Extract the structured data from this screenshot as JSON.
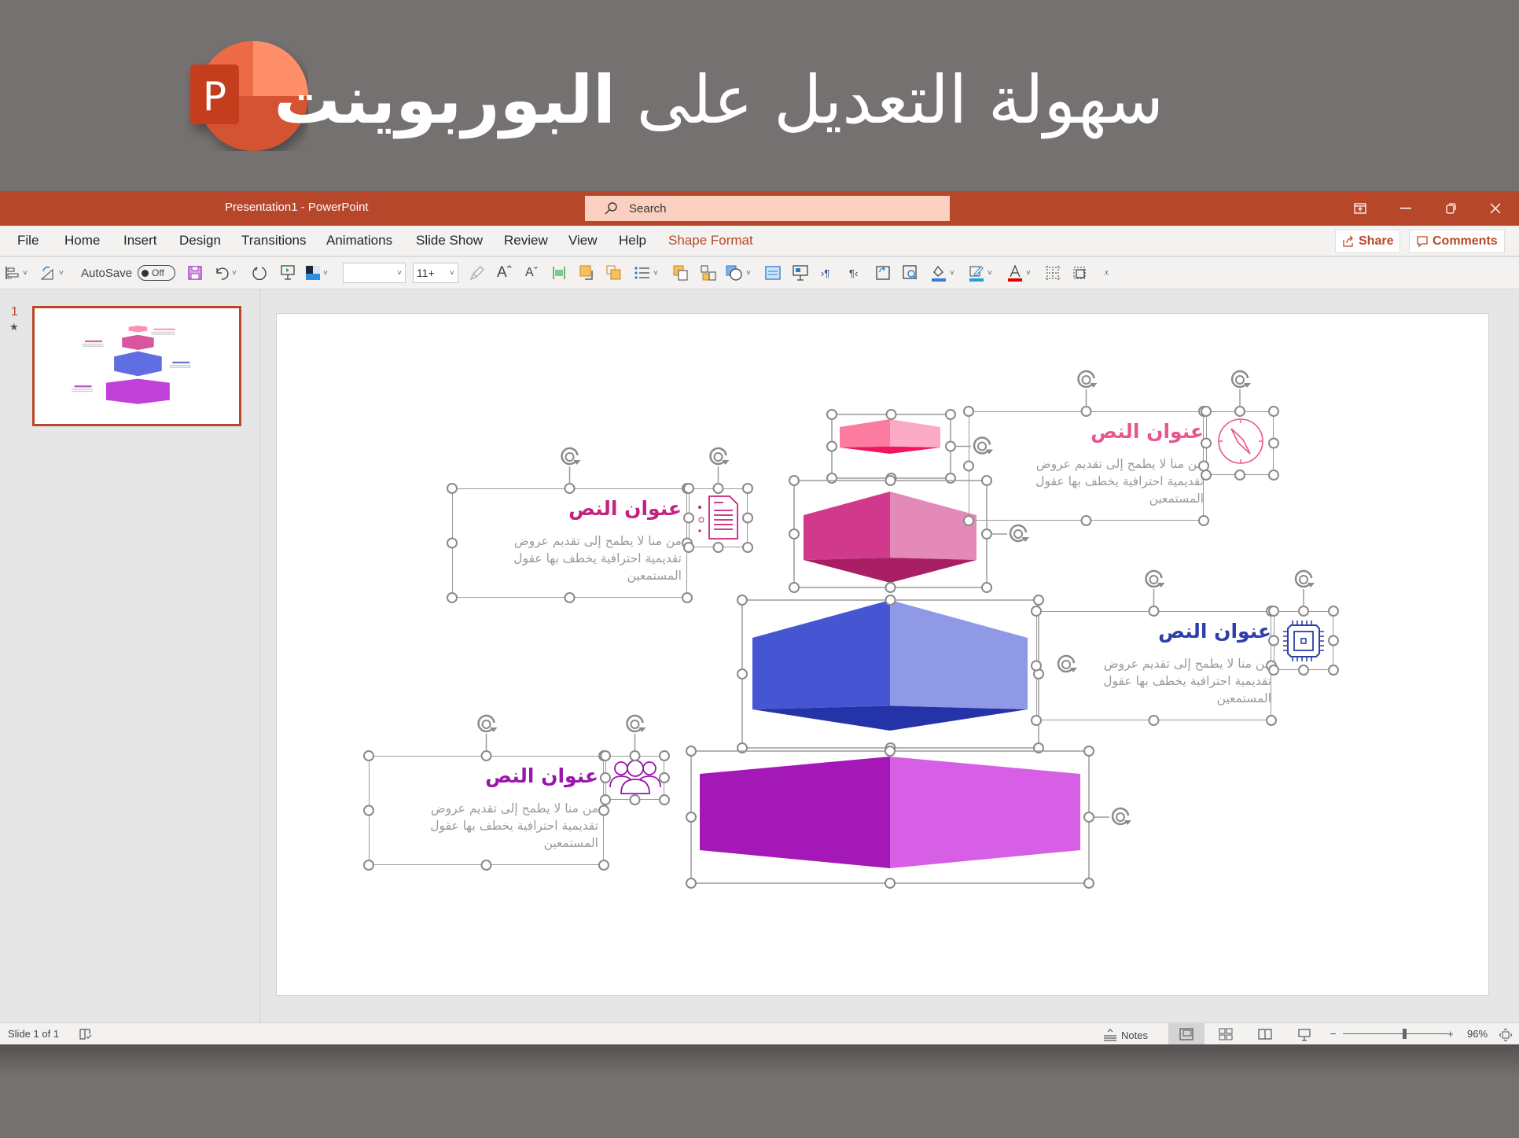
{
  "banner": {
    "title_regular": "سهولة التعديل على",
    "title_bold": "البوربوينت",
    "logo_letter": "P"
  },
  "window": {
    "doc_title": "Presentation1  -  PowerPoint",
    "search_placeholder": "Search",
    "controls": [
      "ribbon-display-icon",
      "minimize-icon",
      "restore-icon",
      "close-icon"
    ]
  },
  "menu": {
    "tabs": [
      "File",
      "Home",
      "Insert",
      "Design",
      "Transitions",
      "Animations",
      "Slide Show",
      "Review",
      "View",
      "Help",
      "Shape Format"
    ],
    "active_tab": "Shape Format",
    "share_label": "Share",
    "comments_label": "Comments"
  },
  "toolbar": {
    "autosave_label": "AutoSave",
    "autosave_state": "Off",
    "font_name_value": "",
    "font_size_value": "11+",
    "icons": [
      "align-icon",
      "rotate-icon",
      "save-icon",
      "undo-icon",
      "redo-icon",
      "from-beginning-icon",
      "theme-colors-icon",
      "format-painter-icon",
      "increase-font-icon",
      "decrease-font-icon",
      "align-distribute-icon",
      "bring-forward-icon",
      "send-backward-icon",
      "bullets-icon",
      "group-icon",
      "ungroup-icon",
      "shapes-icon",
      "selection-pane-icon",
      "present-icon",
      "ltr-icon",
      "rtl-icon",
      "arrange-icon",
      "zoom-icon",
      "shape-fill-icon",
      "shape-outline-icon",
      "font-color-icon",
      "grid-icon",
      "crop-icon",
      "customize-icon"
    ],
    "colors": {
      "fill_bar": "#3a7bd5",
      "outline_bar": "#1ea0d8",
      "font_color_bar": "#e00000"
    }
  },
  "slides_panel": {
    "slide_number": "1",
    "has_animation": true
  },
  "slide": {
    "items": [
      {
        "title": "عنوان النص",
        "body": "من منا لا يطمح إلى تقديم عروض\nتقديمية احترافية يخطف بها عقول\nالمستمعين",
        "color": "#e9558f",
        "icon": "compass-icon"
      },
      {
        "title": "عنوان النص",
        "body": "من منا لا يطمح إلى تقديم عروض\nتقديمية احترافية يخطف بها عقول\nالمستمعين",
        "color": "#c3237f",
        "icon": "document-icon"
      },
      {
        "title": "عنوان النص",
        "body": "من منا لا يطمح إلى تقديم عروض\nتقديمية احترافية يخطف بها عقول\nالمستمعين",
        "color": "#2e3fa8",
        "icon": "chip-icon"
      },
      {
        "title": "عنوان النص",
        "body": "من منا لا يطمح إلى تقديم عروض\nتقديمية احترافية يخطف بها عقول\nالمستمعين",
        "color": "#9a16ad",
        "icon": "users-icon"
      }
    ],
    "blocks": [
      {
        "name": "pink-block",
        "left": "#fd7aa0",
        "right": "#fcaac5",
        "bottom": "#f0155e"
      },
      {
        "name": "magenta-block",
        "left": "#d13a8c",
        "right": "#e48ab9",
        "bottom": "#a81f66"
      },
      {
        "name": "blue-block",
        "left": "#4656d2",
        "right": "#8f99e6",
        "bottom": "#2533a8"
      },
      {
        "name": "purple-block",
        "left": "#a318b6",
        "right": "#d75fe6",
        "bottom": "#c13ed2"
      }
    ]
  },
  "statusbar": {
    "slide_indicator": "Slide 1 of 1",
    "notes_label": "Notes",
    "zoom_percent": "96%",
    "zoom_level": 0.58
  }
}
